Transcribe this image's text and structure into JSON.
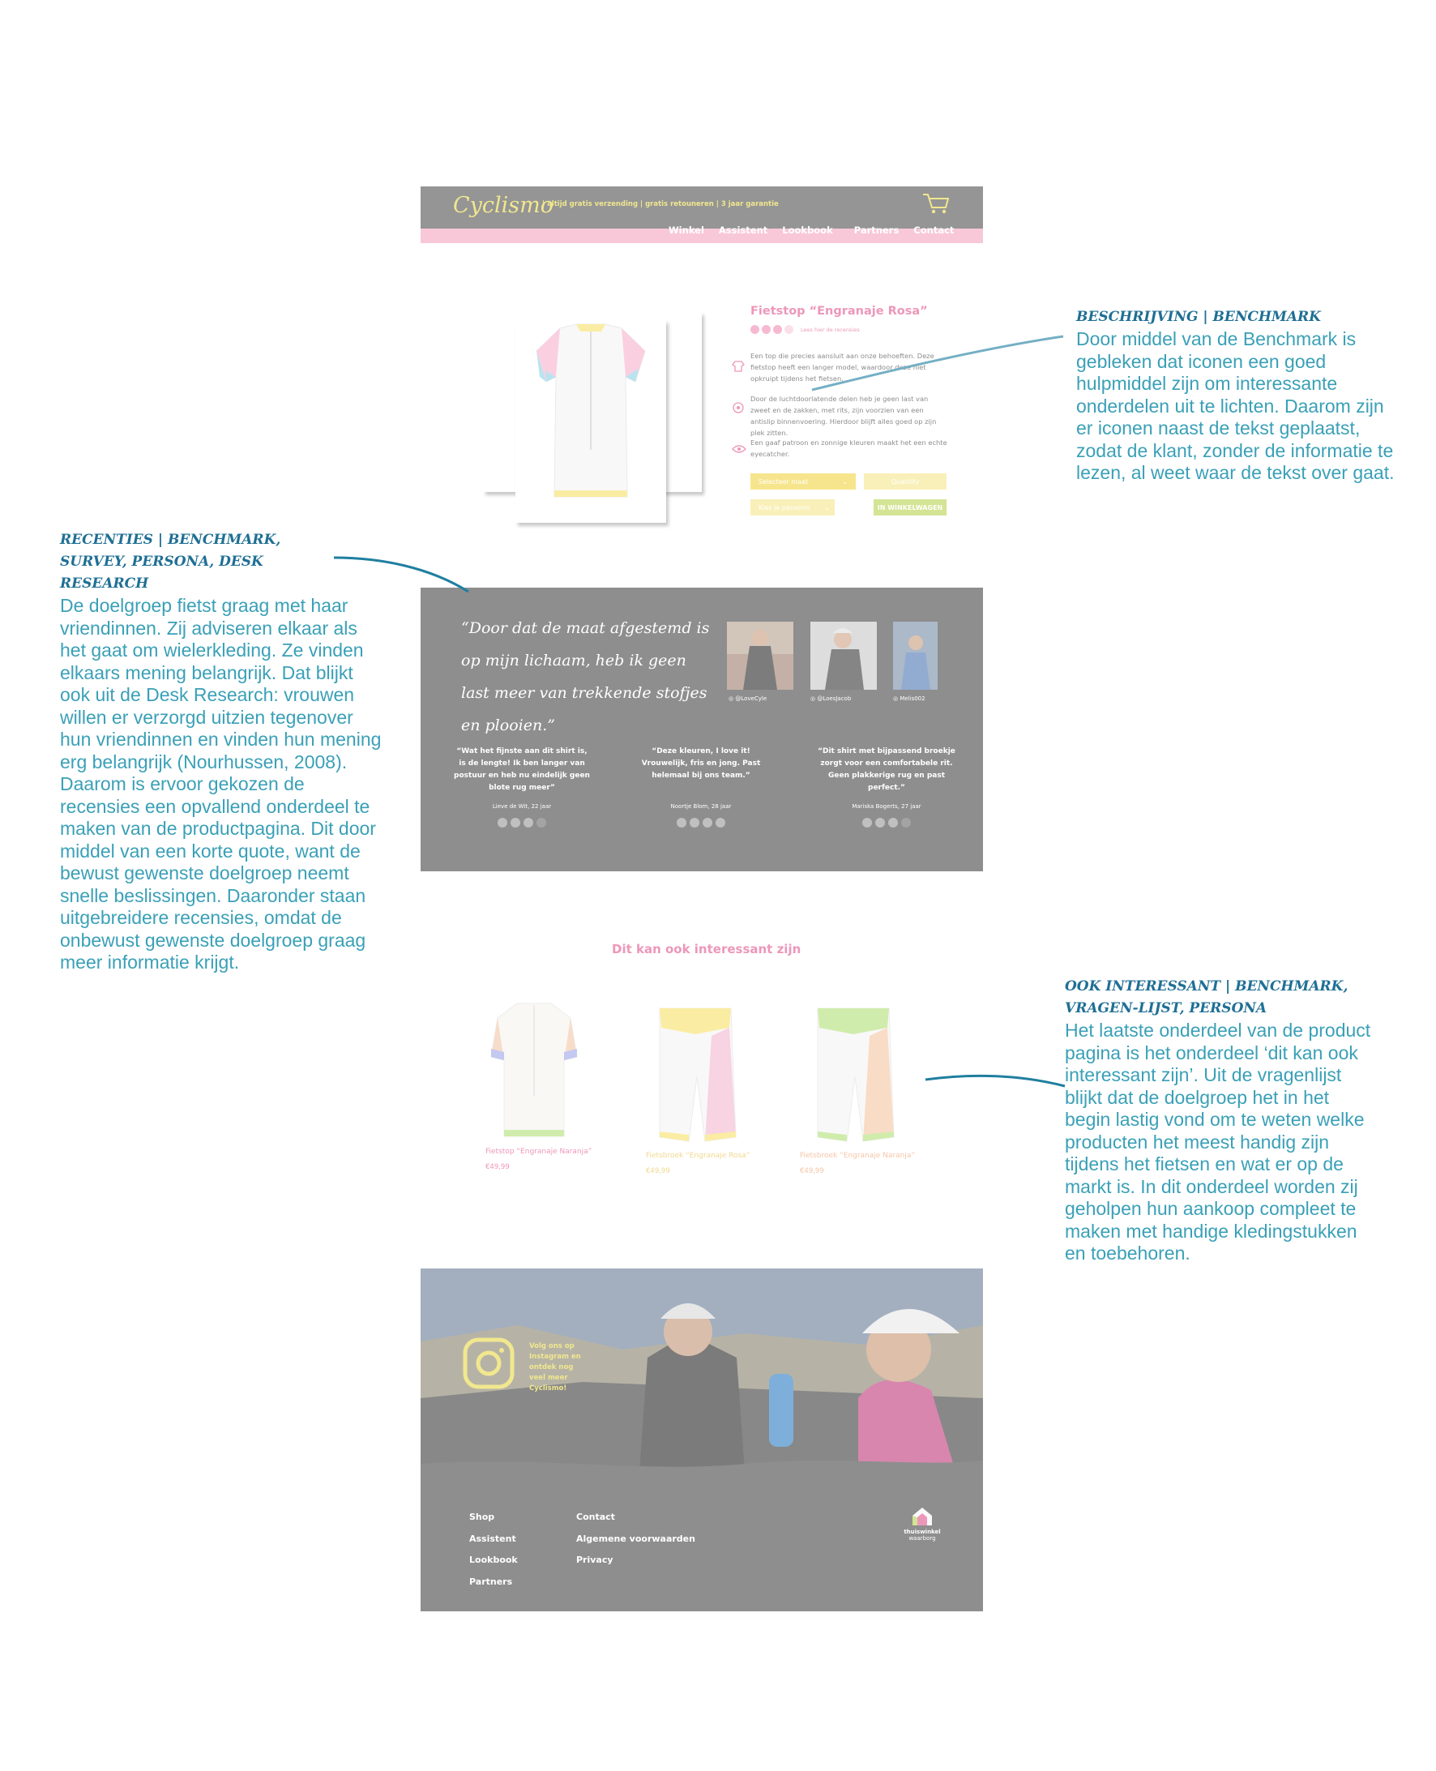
{
  "header": {
    "logo": "Cyclismo",
    "tagline": "| altijd gratis verzending | gratis retouneren | 3 jaar garantie",
    "nav": [
      "Winkel",
      "Assistent",
      "Lookbook",
      "Partners",
      "Contact"
    ]
  },
  "product": {
    "title": "Fietstop “Engranaje Rosa”",
    "rating_text": "Lees hier de recensies",
    "rating": 3,
    "rating_max": 5,
    "features": [
      "Een top die precies aansluit aan onze behoeften. Deze fietstop heeft een langer model, waardoor deze niet opkruipt tijdens het fietsen.",
      "Door de luchtdoorlatende delen heb je geen last van zweet en de zakken, met rits, zijn voorzien van een antislip binnenvoering. Hierdoor blijft alles goed op zijn plek zitten.",
      "Een gaaf patroon en zonnige kleuren maakt het een echte eyecatcher."
    ],
    "size_select": "Selecteer maat",
    "quantity": "Quantity",
    "fit_select": "Kies je pasvorm",
    "cart_button": "IN WINKELWAGEN"
  },
  "reviews": {
    "quote": "“Door dat de maat afgestemd is op mijn lichaam, heb ik geen last meer van trekkende stofjes en plooien.”",
    "instagram": [
      "@LoveCyle",
      "@LoesJacob",
      "Melis002"
    ],
    "items": [
      {
        "text": "“Wat het fijnste aan dit shirt is, is de lengte! Ik ben langer van postuur en heb nu eindelijk geen blote rug meer”",
        "author": "Lieve de Wit, 22 jaar",
        "stars": 3
      },
      {
        "text": "“Deze kleuren, I love it! Vrouwelijk, fris en jong. Past helemaal bij ons team.”",
        "author": "Noortje Blom, 28 jaar",
        "stars": 4
      },
      {
        "text": "“Dit shirt met bijpassend broekje zorgt voor een comfortabele rit. Geen plakkerige rug en past perfect.”",
        "author": "Mariska Bogerts, 27 jaar",
        "stars": 3
      }
    ]
  },
  "related": {
    "heading": "Dit kan ook interessant zijn",
    "items": [
      {
        "name": "Fietstop “Engranaje Naranja”",
        "price": "€49,99"
      },
      {
        "name": "Fietsbroek “Engranaje Rosa”",
        "price": "€49,99"
      },
      {
        "name": "Fietsbroek “Engranaje Naranja”",
        "price": "€49,99"
      }
    ]
  },
  "footer": {
    "instagram_text": "Volg ons op Instagram en ontdek nog veel meer Cyclismo!",
    "col1": [
      "Shop",
      "Assistent",
      "Lookbook",
      "Partners"
    ],
    "col2": [
      "Contact",
      "Algemene voorwaarden",
      "Privacy"
    ],
    "badge_top": "thuiswinkel",
    "badge_bottom": "waarborg"
  },
  "annotations": {
    "beschrijving": {
      "title": "BESCHRIJVING | BENCHMARK",
      "body": "Door middel van de Benchmark is gebleken dat iconen een goed hulpmiddel zijn om interessante onderdelen uit te lichten. Daarom zijn er iconen naast de tekst geplaatst, zodat de klant, zonder de informatie te lezen, al weet waar de tekst over gaat."
    },
    "recenties": {
      "title": "RECENTIES | BENCHMARK, SURVEY, PERSONA, DESK RESEARCH",
      "body": "De doelgroep fietst graag met haar vriendinnen. Zij adviseren elkaar als het gaat om wielerkleding. Ze vinden elkaars mening belangrijk. Dat blijkt ook uit de Desk Research: vrouwen willen er verzorgd uitzien tegenover hun vriendinnen en vinden hun mening erg belangrijk (Nourhussen, 2008). Daarom is ervoor gekozen de recensies een opvallend onderdeel te maken van de productpagina. Dit door middel van een korte quote, want de bewust gewenste doelgroep neemt snelle beslissingen. Daaronder staan uitgebreidere recensies, omdat de onbewust gewenste doelgroep graag meer informatie krijgt."
    },
    "ook": {
      "title": "OOK INTERESSANT | BENCHMARK, VRAGEN-LIJST, PERSONA",
      "body": "Het laatste onderdeel van de product pagina is het onderdeel ‘dit kan ook interessant zijn’. Uit de vragenlijst blijkt dat de doelgroep het in het begin lastig vond om te weten welke producten het meest handig zijn tijdens het fietsen en wat er op de markt is. In dit onderdeel worden zij geholpen hun aankoop compleet te maken met handige kledingstukken en toebehoren."
    }
  },
  "colors": {
    "accent_pink": "#e0578f",
    "brand_yellow": "#e8d84a",
    "annotation_teal": "#3aa0b7",
    "annotation_title": "#1f6f94",
    "dark_grey": "#4a4a4a"
  }
}
